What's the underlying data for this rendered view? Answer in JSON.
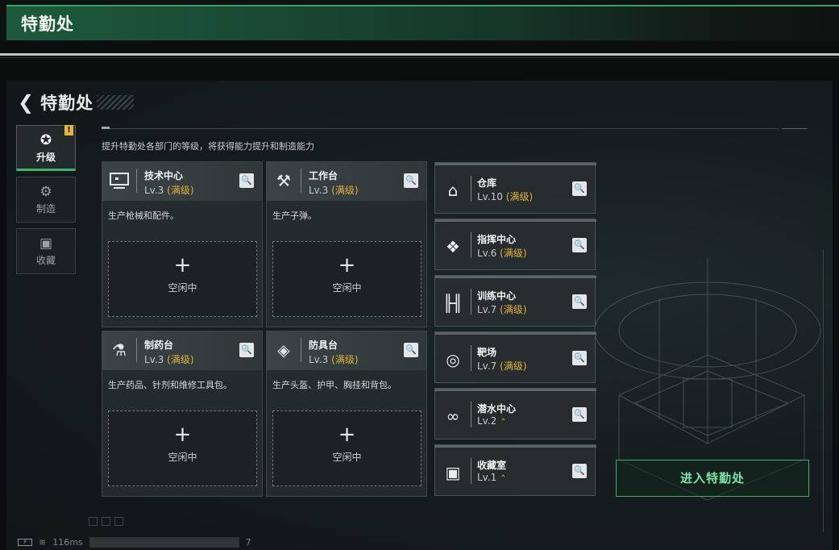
{
  "window": {
    "title": "特勤处"
  },
  "header": {
    "back_label": "特勤处"
  },
  "nav": [
    {
      "label": "升级",
      "icon": "upgrade-icon",
      "active": true,
      "badge": "!"
    },
    {
      "label": "制造",
      "icon": "gears-icon",
      "active": false
    },
    {
      "label": "收藏",
      "icon": "collection-icon",
      "active": false
    }
  ],
  "subtitle": "提升特勤处各部门的等级，将获得能力提升和制造能力",
  "departments": [
    {
      "name": "技术中心",
      "level": "Lv.3",
      "max": "(满级)",
      "desc": "生产枪械和配件。",
      "slot_plus": "+",
      "slot_status": "空闲中",
      "icon": "monitor-icon"
    },
    {
      "name": "工作台",
      "level": "Lv.3",
      "max": "(满级)",
      "desc": "生产子弹。",
      "slot_plus": "+",
      "slot_status": "空闲中",
      "icon": "tools-icon"
    },
    {
      "name": "制药台",
      "level": "Lv.3",
      "max": "(满级)",
      "desc": "生产药品、针剂和维修工具包。",
      "slot_plus": "+",
      "slot_status": "空闲中",
      "icon": "microscope-icon"
    },
    {
      "name": "防具台",
      "level": "Lv.3",
      "max": "(满级)",
      "desc": "生产头盔、护甲、胸挂和背包。",
      "slot_plus": "+",
      "slot_status": "空闲中",
      "icon": "armor-icon"
    }
  ],
  "facilities": [
    {
      "name": "仓库",
      "level": "Lv.10",
      "max": "(满级)",
      "up": "",
      "icon": "warehouse-icon"
    },
    {
      "name": "指挥中心",
      "level": "Lv.6",
      "max": "(满级)",
      "up": "",
      "icon": "chip-icon"
    },
    {
      "name": "训练中心",
      "level": "Lv.7",
      "max": "(满级)",
      "up": "",
      "icon": "dumbbell-icon"
    },
    {
      "name": "靶场",
      "level": "Lv.7",
      "max": "(满级)",
      "up": "",
      "icon": "target-icon"
    },
    {
      "name": "潜水中心",
      "level": "Lv.2",
      "max": "",
      "up": "⌃",
      "icon": "diving-mask-icon"
    },
    {
      "name": "收藏室",
      "level": "Lv.1",
      "max": "",
      "up": "⌃",
      "icon": "vault-icon"
    }
  ],
  "enter_button": "进入特勤处",
  "status": {
    "ping": "116ms",
    "trailing": "7"
  },
  "colors": {
    "accent_green": "#3fae6b",
    "max_gold": "#e0b13c",
    "header_green": "#1d5a3c"
  }
}
